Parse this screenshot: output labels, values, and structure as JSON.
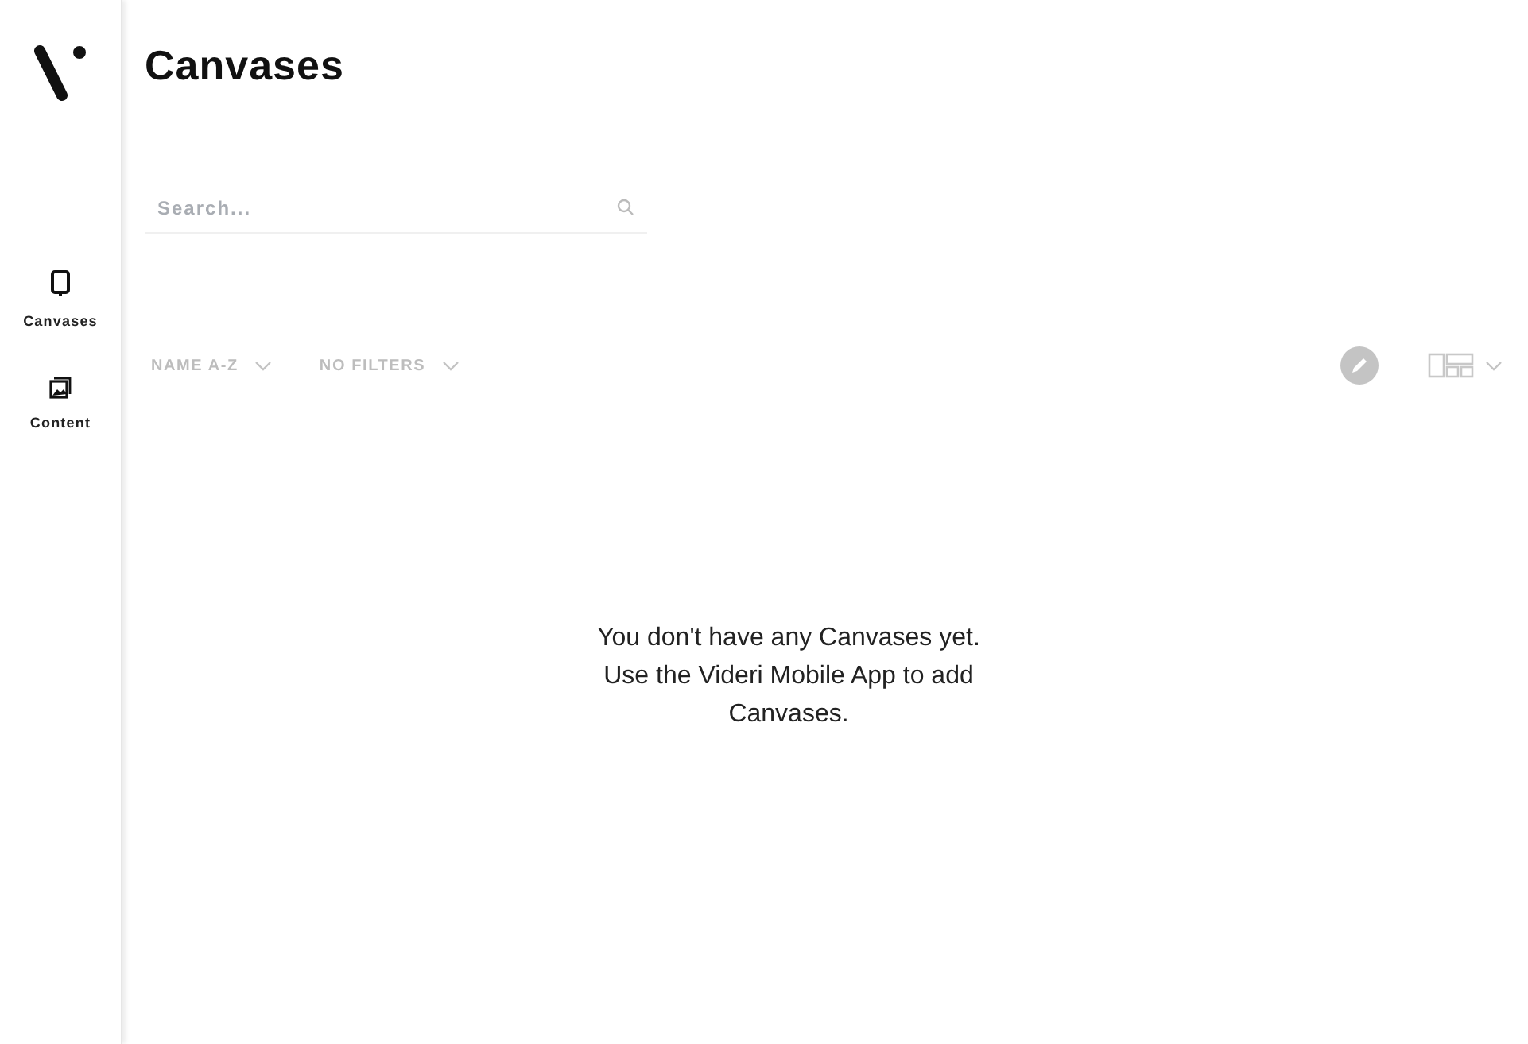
{
  "sidebar": {
    "items": [
      {
        "label": "Canvases",
        "kind": "tablet"
      },
      {
        "label": "Content",
        "kind": "image"
      }
    ]
  },
  "page": {
    "title": "Canvases"
  },
  "search": {
    "placeholder": "Search..."
  },
  "toolbar": {
    "sort": "NAME A-Z",
    "filter": "NO FILTERS"
  },
  "empty_message": [
    "You don't have any Canvases yet.",
    "Use the Videri Mobile App to add",
    "Canvases."
  ]
}
